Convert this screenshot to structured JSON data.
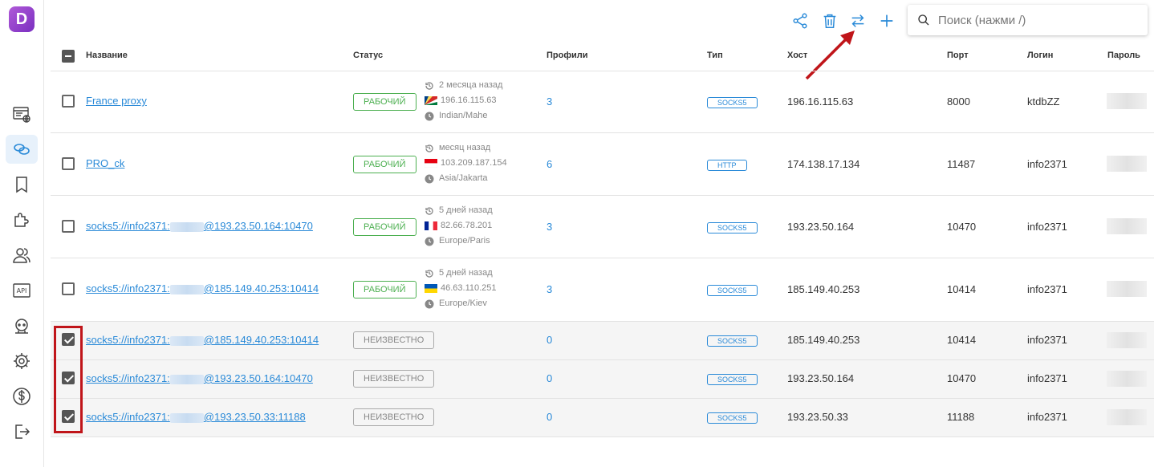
{
  "search": {
    "placeholder": "Поиск (нажми /)"
  },
  "logo": {
    "letter": "D"
  },
  "columns": [
    "Название",
    "Статус",
    "Профили",
    "Тип",
    "Хост",
    "Порт",
    "Логин",
    "Пароль"
  ],
  "rows": [
    {
      "name": "France proxy",
      "status": "РАБОЧИЙ",
      "time": "2 месяца назад",
      "ip": "196.16.115.63",
      "tz": "Indian/Mahe",
      "profiles": "3",
      "type": "SOCKS5",
      "host": "196.16.115.63",
      "port": "8000",
      "login": "ktdbZZ",
      "selected": false
    },
    {
      "name": "PRO_ck",
      "status": "РАБОЧИЙ",
      "time": "месяц назад",
      "ip": "103.209.187.154",
      "tz": "Asia/Jakarta",
      "profiles": "6",
      "type": "HTTP",
      "host": "174.138.17.134",
      "port": "11487",
      "login": "info2371",
      "selected": false
    },
    {
      "name_pre": "socks5://info2371:",
      "name_post": "@193.23.50.164:10470",
      "status": "РАБОЧИЙ",
      "time": "5 дней назад",
      "ip": "82.66.78.201",
      "tz": "Europe/Paris",
      "profiles": "3",
      "type": "SOCKS5",
      "host": "193.23.50.164",
      "port": "10470",
      "login": "info2371",
      "selected": false
    },
    {
      "name_pre": "socks5://info2371:",
      "name_post": "@185.149.40.253:10414",
      "status": "РАБОЧИЙ",
      "time": "5 дней назад",
      "ip": "46.63.110.251",
      "tz": "Europe/Kiev",
      "profiles": "3",
      "type": "SOCKS5",
      "host": "185.149.40.253",
      "port": "10414",
      "login": "info2371",
      "selected": false
    },
    {
      "name_pre": "socks5://info2371:",
      "name_post": "@185.149.40.253:10414",
      "status": "НЕИЗВЕСТНО",
      "profiles": "0",
      "type": "SOCKS5",
      "host": "185.149.40.253",
      "port": "10414",
      "login": "info2371",
      "selected": true
    },
    {
      "name_pre": "socks5://info2371:",
      "name_post": "@193.23.50.164:10470",
      "status": "НЕИЗВЕСТНО",
      "profiles": "0",
      "type": "SOCKS5",
      "host": "193.23.50.164",
      "port": "10470",
      "login": "info2371",
      "selected": true
    },
    {
      "name_pre": "socks5://info2371:",
      "name_post": "@193.23.50.33:11188",
      "status": "НЕИЗВЕСТНО",
      "profiles": "0",
      "type": "SOCKS5",
      "host": "193.23.50.33",
      "port": "11188",
      "login": "info2371",
      "selected": true
    }
  ],
  "colors": {
    "accent": "#2a8ad8",
    "ok": "#4caf50",
    "highlight": "#c0151a"
  }
}
